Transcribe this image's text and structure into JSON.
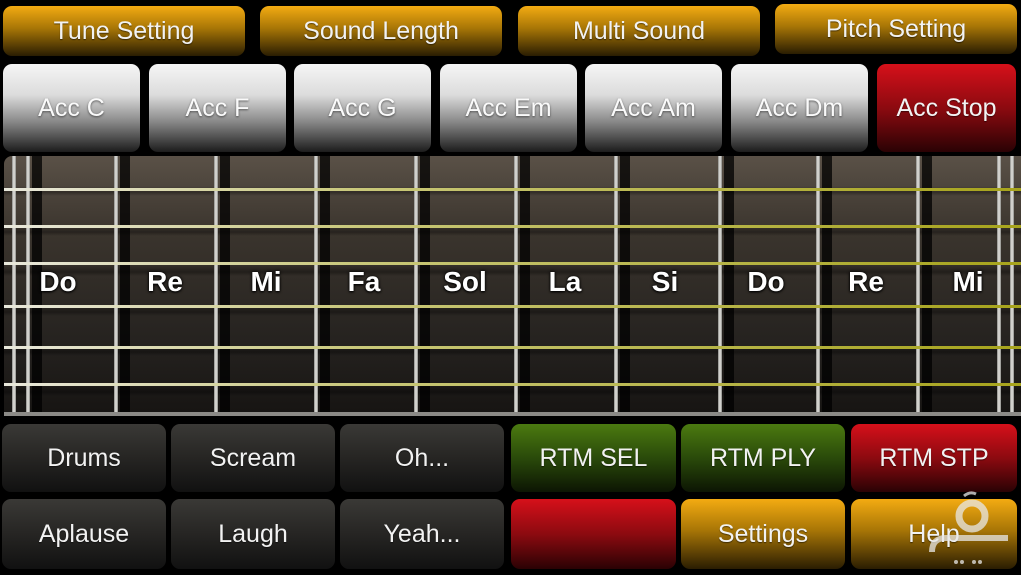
{
  "top_menu": [
    {
      "label": "Tune Setting"
    },
    {
      "label": "Sound Length"
    },
    {
      "label": "Multi Sound"
    },
    {
      "label": "Pitch Setting"
    }
  ],
  "accompaniment": [
    {
      "label": "Acc C"
    },
    {
      "label": "Acc F"
    },
    {
      "label": "Acc G"
    },
    {
      "label": "Acc Em"
    },
    {
      "label": "Acc Am"
    },
    {
      "label": "Acc Dm"
    },
    {
      "label": "Acc Stop"
    }
  ],
  "fretboard": {
    "notes": [
      "Do",
      "Re",
      "Mi",
      "Fa",
      "Sol",
      "La",
      "Si",
      "Do",
      "Re",
      "Mi"
    ],
    "string_count": 6
  },
  "effects_row1": [
    {
      "label": "Drums"
    },
    {
      "label": "Scream"
    },
    {
      "label": "Oh..."
    },
    {
      "label": "RTM SEL"
    },
    {
      "label": "RTM PLY"
    },
    {
      "label": "RTM STP"
    }
  ],
  "effects_row2": [
    {
      "label": "Aplause"
    },
    {
      "label": "Laugh"
    },
    {
      "label": "Yeah..."
    },
    {
      "label": ""
    },
    {
      "label": "Settings"
    },
    {
      "label": "Help"
    }
  ],
  "colors": {
    "gold": "#f3ab12",
    "red": "#d6101a",
    "green": "#4b7a10",
    "string": "#a7a41c"
  }
}
